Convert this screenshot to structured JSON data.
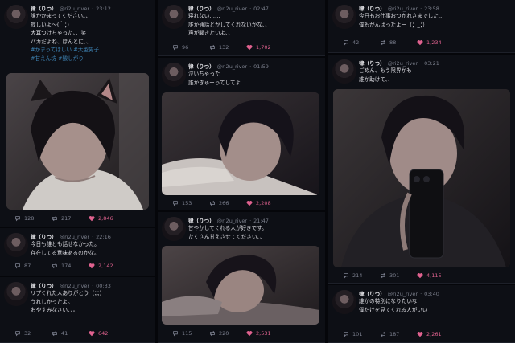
{
  "col1": [
    {
      "name": "律（りつ）",
      "handle": "@ri2u_river",
      "time": "23:12",
      "lines": [
        "誰かかまってください。、",
        "寂しいよ〜(｀；)",
        "大耳つけちゃった、、笑",
        "バカだよね、ほんとに、、"
      ],
      "tags": [
        "#かまってほしい",
        "#大型男子",
        "#甘えん坊",
        "#酸しがり"
      ],
      "replies": "128",
      "retweets": "217",
      "likes": "2,846"
    },
    {
      "name": "律（りつ）",
      "handle": "@ri2u_river",
      "time": "22:16",
      "lines": [
        "今日も誰とも話せなかった。",
        "存在してる意味あるのかな。"
      ],
      "replies": "87",
      "retweets": "174",
      "likes": "2,142"
    },
    {
      "name": "律（りつ）",
      "handle": "@ri2u_river",
      "time": "00:33",
      "lines": [
        "リプくれた人ありがとう（；；）",
        "うれしかったよ。",
        "おやすみなさい、、。"
      ],
      "replies": "32",
      "retweets": "41",
      "likes": "642"
    }
  ],
  "col2": [
    {
      "name": "律（りつ）",
      "handle": "@ri2u_river",
      "time": "02:47",
      "lines": [
        "寝れない……",
        "誰か通話とかしてくれないかな、、",
        "声が聞きたいよ、、"
      ],
      "replies": "96",
      "retweets": "132",
      "likes": "1,702"
    },
    {
      "name": "律（りつ）",
      "handle": "@ri2u_river",
      "time": "01:59",
      "lines": [
        "泣いちゃった",
        "誰かぎゅーってしてよ……"
      ],
      "replies": "153",
      "retweets": "266",
      "likes": "2,208"
    },
    {
      "name": "律（りつ）",
      "handle": "@ri2u_river",
      "time": "21:47",
      "lines": [
        "甘やかしてくれる人が好きです。",
        "たくさん甘えさせてください、、"
      ],
      "replies": "115",
      "retweets": "220",
      "likes": "2,531"
    }
  ],
  "col3": [
    {
      "name": "律（りつ）",
      "handle": "@ri2u_river",
      "time": "23:58",
      "lines": [
        "今日もお仕事おつかれさまでした…",
        "僕もがんばったよー（；_；）"
      ],
      "replies": "42",
      "retweets": "88",
      "likes": "1,234"
    },
    {
      "name": "律（りつ）",
      "handle": "@ri2u_river",
      "time": "03:21",
      "lines": [
        "ごめん、もう限界かも",
        "誰か助けて、、"
      ],
      "replies": "214",
      "retweets": "301",
      "likes": "4,115"
    },
    {
      "name": "律（りつ）",
      "handle": "@ri2u_river",
      "time": "03:40",
      "lines": [
        "誰かの特別になりたいな",
        "僕だけを見てくれる人がいい"
      ],
      "replies": "101",
      "retweets": "187",
      "likes": "2,261"
    }
  ],
  "colors": {
    "background": "#05060a",
    "card": "#0d0f15",
    "like": "#e0628f",
    "hashtag": "#3f86b8"
  },
  "icons": [
    "reply-icon",
    "retweet-icon",
    "heart-icon"
  ]
}
